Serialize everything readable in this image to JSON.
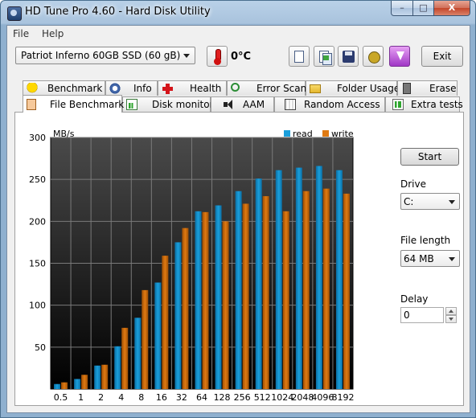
{
  "window": {
    "title": "HD Tune Pro 4.60 - Hard Disk Utility",
    "min_glyph": "–",
    "max_glyph": "□",
    "close_glyph": "X"
  },
  "menu": [
    {
      "label": "File"
    },
    {
      "label": "Help"
    }
  ],
  "toolbar": {
    "drive": "Patriot Inferno 60GB SSD (60 gB)",
    "temperature": "0°C",
    "exit_label": "Exit"
  },
  "tabs_row1": [
    {
      "label": "Benchmark",
      "icon": "medal-icon"
    },
    {
      "label": "Info",
      "icon": "info-icon"
    },
    {
      "label": "Health",
      "icon": "health-cross-icon"
    },
    {
      "label": "Error Scan",
      "icon": "magnifier-icon"
    },
    {
      "label": "Folder Usage",
      "icon": "folder-icon"
    },
    {
      "label": "Erase",
      "icon": "trash-icon"
    }
  ],
  "tabs_row2": [
    {
      "label": "File Benchmark",
      "icon": "file-icon",
      "active": true
    },
    {
      "label": "Disk monitor",
      "icon": "monitor-icon"
    },
    {
      "label": "AAM",
      "icon": "speaker-icon"
    },
    {
      "label": "Random Access",
      "icon": "random-access-icon"
    },
    {
      "label": "Extra tests",
      "icon": "extra-tests-icon"
    }
  ],
  "side": {
    "start_label": "Start",
    "drive_label": "Drive",
    "drive_value": "C:",
    "file_length_label": "File length",
    "file_length_value": "64 MB",
    "delay_label": "Delay",
    "delay_value": "0"
  },
  "colors": {
    "read": "#1a9fdc",
    "write": "#e07a12",
    "plot_bg_top": "#4a4a4a",
    "plot_bg_bottom": "#000000"
  },
  "chart_data": {
    "type": "bar",
    "ylabel": "MB/s",
    "ylim": [
      0,
      300
    ],
    "yticks": [
      50,
      100,
      150,
      200,
      250,
      300
    ],
    "grid": true,
    "legend_position": "top-right",
    "categories": [
      "0.5",
      "1",
      "2",
      "4",
      "8",
      "16",
      "32",
      "64",
      "128",
      "256",
      "512",
      "1024",
      "2048",
      "4096",
      "8192"
    ],
    "series": [
      {
        "name": "read",
        "values": [
          6,
          12,
          28,
          51,
          85,
          127,
          175,
          212,
          219,
          236,
          251,
          261,
          264,
          266,
          261
        ]
      },
      {
        "name": "write",
        "values": [
          8,
          17,
          29,
          73,
          118,
          159,
          192,
          211,
          200,
          221,
          230,
          212,
          236,
          239,
          233
        ]
      }
    ]
  }
}
